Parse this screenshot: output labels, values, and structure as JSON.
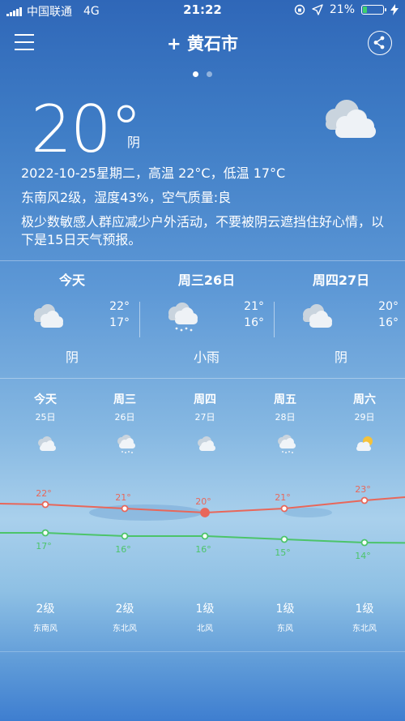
{
  "status_bar": {
    "carrier": "中国联通",
    "network": "4G",
    "time": "21:22",
    "battery": "21%",
    "battery_level": 0.21
  },
  "header": {
    "city": "+ 黄石市"
  },
  "current": {
    "temperature": "20°",
    "condition": "阴",
    "line1": "2022-10-25星期二，高温 22°C，低温 17°C",
    "line2": "东南风2级，湿度43%，空气质量:良",
    "line3": "极少数敏感人群应减少户外活动，不要被阴云遮挡住好心情，以下是15日天气预报。"
  },
  "three_day": [
    {
      "name": "今天",
      "high": "22°",
      "low": "17°",
      "cond": "阴",
      "icon": "cloudy-icon"
    },
    {
      "name": "周三26日",
      "high": "21°",
      "low": "16°",
      "cond": "小雨",
      "icon": "rain-icon"
    },
    {
      "name": "周四27日",
      "high": "20°",
      "low": "16°",
      "cond": "阴",
      "icon": "cloudy-icon"
    }
  ],
  "forecast": [
    {
      "week": "今天",
      "date": "25日",
      "icon": "cloudy-icon",
      "wind_level": "2级",
      "wind_dir": "东南风"
    },
    {
      "week": "周三",
      "date": "26日",
      "icon": "rain-icon",
      "wind_level": "2级",
      "wind_dir": "东北风"
    },
    {
      "week": "周四",
      "date": "27日",
      "icon": "cloudy-icon",
      "wind_level": "1级",
      "wind_dir": "北风"
    },
    {
      "week": "周五",
      "date": "28日",
      "icon": "rain-icon",
      "wind_level": "1级",
      "wind_dir": "东风"
    },
    {
      "week": "周六",
      "date": "29日",
      "icon": "partly-cloudy-icon",
      "wind_level": "1级",
      "wind_dir": "东北风"
    }
  ],
  "chart_data": {
    "type": "line",
    "categories": [
      "25日",
      "26日",
      "27日",
      "28日",
      "29日"
    ],
    "series": [
      {
        "values": [
          22,
          21,
          20,
          21,
          23
        ]
      },
      {
        "values": [
          17,
          16,
          16,
          15,
          14
        ]
      }
    ],
    "high_labels": [
      "22°",
      "21°",
      "20°",
      "21°",
      "23°"
    ],
    "low_labels": [
      "17°",
      "16°",
      "16°",
      "15°",
      "14°"
    ]
  },
  "colors": {
    "high_line": "#e8675a",
    "low_line": "#4cc46a",
    "battery_fill": "#3dd16c"
  }
}
